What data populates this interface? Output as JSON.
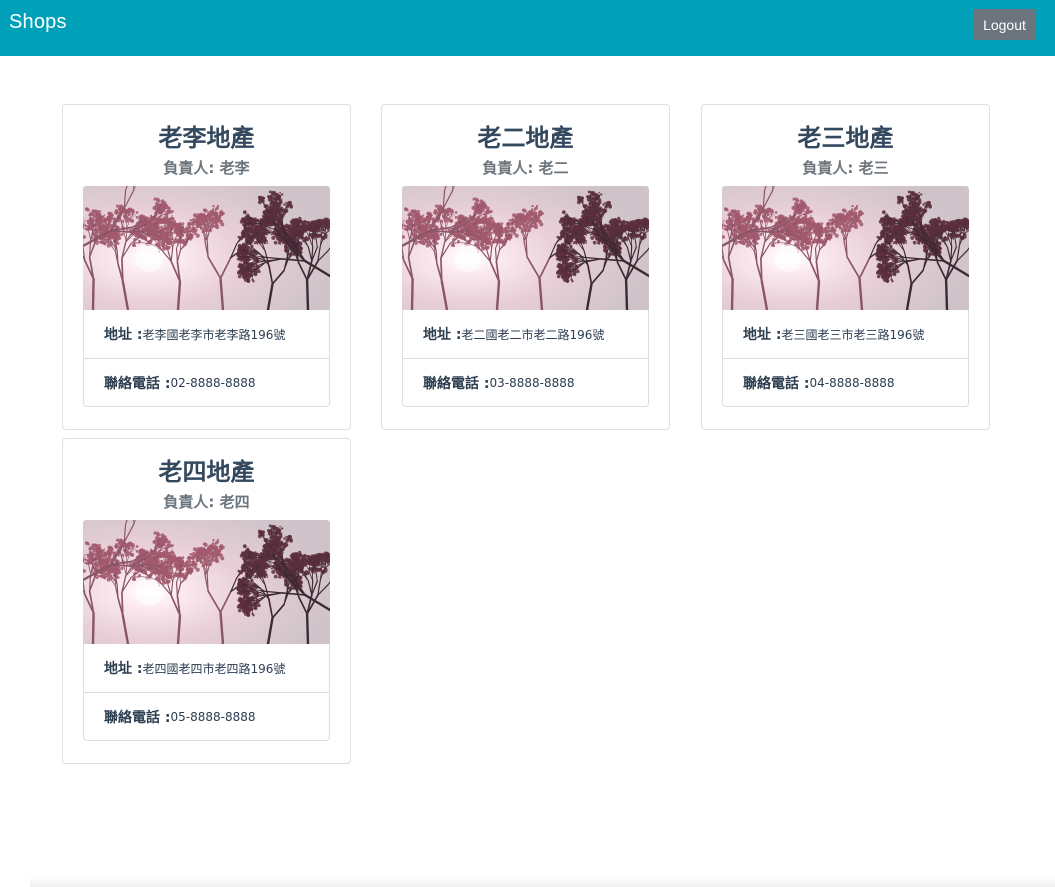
{
  "navbar": {
    "brand": "Shops",
    "logout_label": "Logout",
    "color": "#00a0b8"
  },
  "shops": [
    {
      "name": "老李地產",
      "manager": "負責人: 老李",
      "address_label": "地址 :",
      "address": "老李國老李市老李路196號",
      "phone_label": "聯絡電話 :",
      "phone": "02-8888-8888"
    },
    {
      "name": "老二地產",
      "manager": "負責人: 老二",
      "address_label": "地址 :",
      "address": "老二國老二市老二路196號",
      "phone_label": "聯絡電話 :",
      "phone": "03-8888-8888"
    },
    {
      "name": "老三地產",
      "manager": "負責人: 老三",
      "address_label": "地址 :",
      "address": "老三國老三市老三路196號",
      "phone_label": "聯絡電話 :",
      "phone": "04-8888-8888"
    },
    {
      "name": "老四地產",
      "manager": "負責人: 老四",
      "address_label": "地址 :",
      "address": "老四國老四市老四路196號",
      "phone_label": "聯絡電話 :",
      "phone": "05-8888-8888"
    }
  ]
}
